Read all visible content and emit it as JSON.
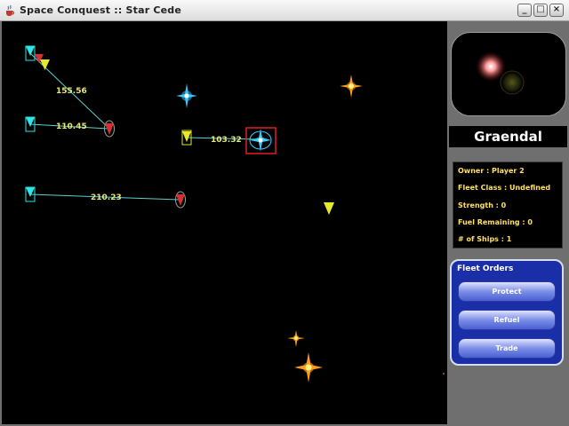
{
  "window": {
    "title": "Space Conquest :: Star Cede",
    "controls": {
      "minimize": "_",
      "maximize": "□",
      "close": "×"
    }
  },
  "map": {
    "distances": [
      "155.56",
      "110.45",
      "103.32",
      "210.23"
    ],
    "colors": {
      "fleet_cyan": "#2ee6e6",
      "fleet_yellow": "#e8e82a",
      "route_line": "#5fd0d0",
      "selection": "#e02020",
      "star_blue": "#38c8ff",
      "star_orange": "#ff9a20"
    }
  },
  "panel": {
    "planet_name": "Graendal",
    "info": {
      "owner": "Owner : Player 2",
      "fleet_class": "Fleet Class : Undefined",
      "strength": "Strength : 0",
      "fuel": "Fuel Remaining : 0",
      "ships": "# of Ships : 1"
    },
    "orders": {
      "title": "Fleet Orders",
      "buttons": [
        "Protect",
        "Refuel",
        "Trade"
      ]
    }
  }
}
